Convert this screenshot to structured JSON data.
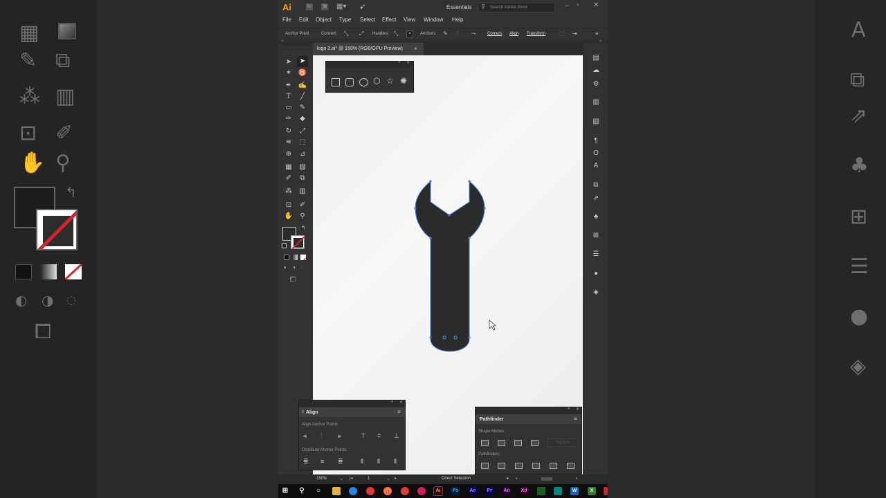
{
  "app": {
    "logo": "Ai",
    "br_icon": "Br",
    "st_icon": "St",
    "workspace": "Essentials",
    "search_placeholder": "Search Adobe Stock"
  },
  "menu": [
    "File",
    "Edit",
    "Object",
    "Type",
    "Select",
    "Effect",
    "View",
    "Window",
    "Help"
  ],
  "control_bar": {
    "anchor_point": "Anchor Point",
    "convert": "Convert:",
    "handles": "Handles:",
    "anchors": "Anchors:",
    "corners": "Corners",
    "align": "Align",
    "transform": "Transform"
  },
  "document": {
    "tab_title": "logo 2.ai* @ 150% (RGB/GPU Preview)",
    "close": "×"
  },
  "align_panel": {
    "title": "Align",
    "align_anchor_points": "Align Anchor Points:",
    "distribute_anchor_points": "Distribute Anchor Points:"
  },
  "pathfinder_panel": {
    "title": "Pathfinder",
    "shape_modes": "Shape Modes:",
    "pathfinders": "Pathfinders:",
    "expand": "Expand"
  },
  "status_bar": {
    "zoom": "150%",
    "artboard": "1",
    "tool": "Direct Selection"
  },
  "colors": {
    "accent": "#ff9a00",
    "wrench_fill": "#2b2b2b",
    "path_selection": "#4a7bd6"
  },
  "icons": {
    "selection": "selection-tool-icon",
    "direct_selection": "direct-selection-tool-icon",
    "pen": "pen-tool-icon",
    "type": "type-tool-icon",
    "hand": "hand-tool-icon",
    "zoom": "zoom-tool-icon"
  }
}
